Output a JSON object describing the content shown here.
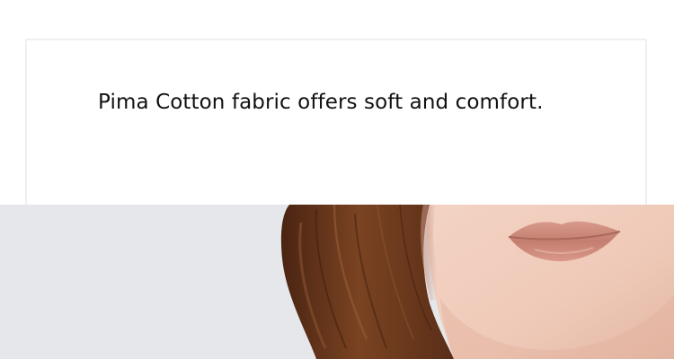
{
  "feature": {
    "caption": "Pima Cotton fabric offers soft and comfort."
  },
  "product_photo": {
    "subject": "model-face-closeup",
    "background_color": "#e6e7ea",
    "skin_color": "#efc9b8",
    "hair_color": "#6b3a1f",
    "lip_color": "#c98576"
  }
}
